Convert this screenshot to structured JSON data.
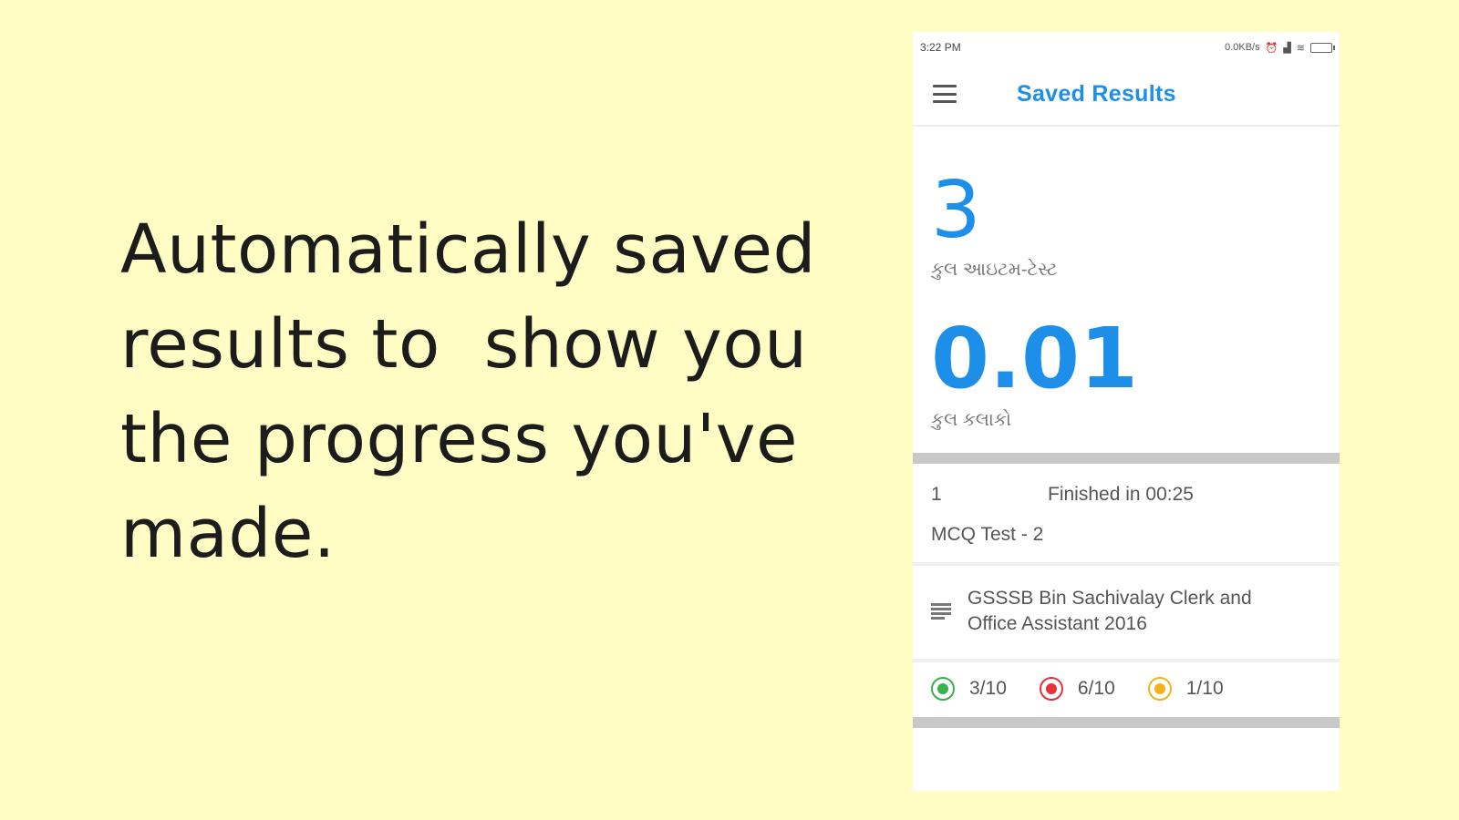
{
  "promo": {
    "lines": [
      "Automatically saved",
      "results to  show you",
      "the progress you've",
      "made."
    ]
  },
  "phone": {
    "status": {
      "time": "3:22 PM",
      "speed": "0.0KB/s"
    },
    "appbar": {
      "title": "Saved Results",
      "menu_icon": "hamburger-menu-icon"
    },
    "stats": {
      "tests_count": "3",
      "tests_label": "કુલ આઇટમ-ટેસ્ટ",
      "marks_value": "0.01",
      "marks_label": "કુલ કલાકો"
    },
    "result": {
      "number": "1",
      "duration": "Finished in 00:25",
      "name": "MCQ Test - 2",
      "exam": "GSSSB Bin Sachivalay Clerk and Office Assistant 2016",
      "scores": [
        {
          "label": "3/10",
          "status": "correct",
          "color": "#34b34a"
        },
        {
          "label": "6/10",
          "status": "wrong",
          "color": "#e8313a"
        },
        {
          "label": "1/10",
          "status": "skipped",
          "color": "#f4b21a"
        }
      ]
    },
    "accent_color": "#1e8fe8"
  }
}
